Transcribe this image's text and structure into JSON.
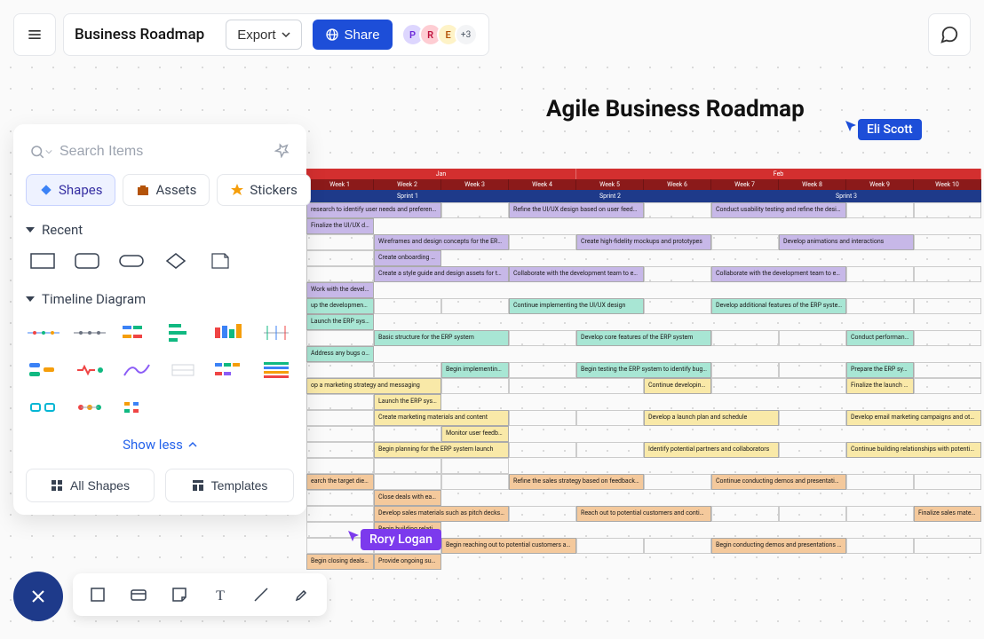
{
  "header": {
    "title": "Business Roadmap",
    "export_label": "Export",
    "share_label": "Share",
    "collaborators": [
      "P",
      "R",
      "E"
    ],
    "collab_more": "+3"
  },
  "shapes_panel": {
    "search_placeholder": "Search Items",
    "tabs": {
      "shapes": "Shapes",
      "assets": "Assets",
      "stickers": "Stickers"
    },
    "sections": {
      "recent": "Recent",
      "timeline": "Timeline Diagram"
    },
    "show_less": "Show less",
    "footer": {
      "all_shapes": "All Shapes",
      "templates": "Templates"
    }
  },
  "canvas": {
    "title": "Agile Business Roadmap",
    "cursors": {
      "eli": "Eli Scott",
      "rory": "Rory Logan"
    }
  },
  "roadmap": {
    "months": [
      "Jan",
      "Feb"
    ],
    "weeks": [
      "Week 1",
      "Week 2",
      "Week 3",
      "Week 4",
      "Week 5",
      "Week 6",
      "Week 7",
      "Week 8",
      "Week 9",
      "Week 10"
    ],
    "sprints": [
      "Sprint 1",
      "Sprint 2",
      "Sprint 3"
    ],
    "sections": [
      {
        "theme": "purple",
        "rows": [
          [
            "research to identify user needs and preferences",
            "",
            "Refine the UI/UX design based on user feedback and testing",
            "",
            "Conduct usability testing and refine the design",
            "",
            "",
            "Finalize the UI/UX design an"
          ],
          [
            "",
            "Wireframes and design concepts for the ERP software",
            "",
            "Create high-fidelity mockups and prototypes",
            "",
            "Develop animations and interactions",
            "",
            "",
            "Create onboarding materials"
          ],
          [
            "",
            "Create a style guide and design assets for the ERP system",
            "Collaborate with the development team to ensure the design is feasible",
            "",
            "Collaborate with the development team to ensure a seamless integration",
            "",
            "",
            "Work with the development"
          ]
        ]
      },
      {
        "theme": "teal",
        "rows": [
          [
            "up the development vironment and tools",
            "",
            "",
            "Continue implementing the UI/UX design",
            "",
            "Develop additional features of the ERP system",
            "",
            "",
            "Launch the ERP system and monitor user feedback"
          ],
          [
            "",
            "Basic structure for the ERP system",
            "",
            "Develop core features of the ERP system",
            "",
            "",
            "Conduct performance testing",
            "",
            "Address any bugs or usability"
          ],
          [
            "",
            "",
            "Begin implementing the UI/UX design",
            "",
            "Begin testing the ERP system to identify bugs and usability issues",
            "",
            "",
            "Prepare the ERP system for launch",
            ""
          ]
        ]
      },
      {
        "theme": "yellow",
        "rows": [
          [
            "op a marketing strategy and messaging",
            "",
            "",
            "Continue developing marketing materials and content",
            "",
            "Finalize the launch plan and schedule",
            "",
            "",
            "Launch the ERP system and"
          ],
          [
            "",
            "Create marketing materials and content",
            "",
            "",
            "Develop a launch plan and schedule",
            "",
            "Develop email marketing campaigns and other promotional materials",
            "",
            "",
            "Monitor user feedback and a"
          ],
          [
            "",
            "Begin planning for the ERP system launch",
            "",
            "",
            "Identify potential partners and collaborators",
            "",
            "Continue building relationships with potential partners and collaborators",
            "",
            "",
            ""
          ]
        ]
      },
      {
        "theme": "orange",
        "rows": [
          [
            "earch the target dience and develop a s strategy",
            "",
            "",
            "Refine the sales strategy based on feedback and data",
            "",
            "Continue conducting demos and presentations of the ERP system",
            "",
            "",
            "",
            "Close deals with early adop"
          ],
          [
            "",
            "Develop sales materials such as pitch decks and sales scripts",
            "",
            "Reach out to potential customers and continue building relationships",
            "",
            "",
            "",
            "Finalize sales materials and strategies",
            "",
            "Begin building relationships"
          ],
          [
            "",
            "",
            "Begin reaching out to potential customers and building relationships",
            "",
            "",
            "Begin conducting demos and presentations of the ERP system",
            "",
            "",
            "Begin closing deals with early adopters",
            "Provide ongoing support for"
          ]
        ]
      }
    ]
  }
}
